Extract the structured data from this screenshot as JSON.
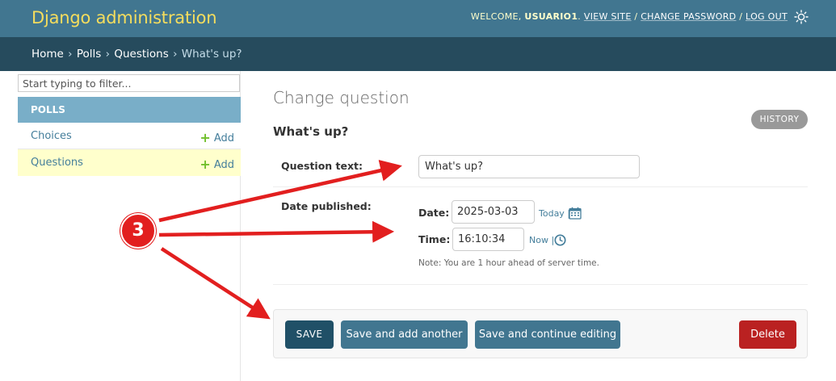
{
  "header": {
    "brand": "Django administration",
    "welcome": "WELCOME,",
    "username": "USUARIO1",
    "view_site": "VIEW SITE",
    "change_password": "CHANGE PASSWORD",
    "log_out": "LOG OUT",
    "separator": "/",
    "theme_icon": "sun-icon"
  },
  "breadcrumbs": {
    "home": "Home",
    "app": "Polls",
    "model": "Questions",
    "current": "What's up?",
    "separator": "›"
  },
  "sidebar": {
    "filter_placeholder": "Start typing to filter...",
    "app_caption": "POLLS",
    "models": [
      {
        "name": "Choices",
        "add_label": "Add",
        "selected": false
      },
      {
        "name": "Questions",
        "add_label": "Add",
        "selected": true
      }
    ]
  },
  "content": {
    "title": "Change question",
    "history_label": "HISTORY",
    "object_name": "What's up?",
    "fields": {
      "question_text_label": "Question text:",
      "question_text_value": "What's up?",
      "date_published_label": "Date published:",
      "date_label": "Date:",
      "date_value": "2025-03-03",
      "today_link": "Today",
      "time_label": "Time:",
      "time_value": "16:10:34",
      "now_link": "Now",
      "shortcut_separator": "|",
      "tz_note": "Note: You are 1 hour ahead of server time."
    },
    "buttons": {
      "save": "SAVE",
      "save_add_another": "Save and add another",
      "save_continue": "Save and continue editing",
      "delete": "Delete"
    }
  },
  "annotation": {
    "step_number": "3",
    "color": "#e21f1f"
  },
  "colors": {
    "header_bg": "#417690",
    "brand": "#f5dd5d",
    "breadcrumbs_bg": "#264b5d",
    "caption_bg": "#79aec8",
    "selected_row_bg": "#ffffcc",
    "save_bg": "#205067",
    "button_bg": "#417690",
    "delete_bg": "#ba2121",
    "link": "#447e9b",
    "add_plus": "#70bf2b"
  }
}
